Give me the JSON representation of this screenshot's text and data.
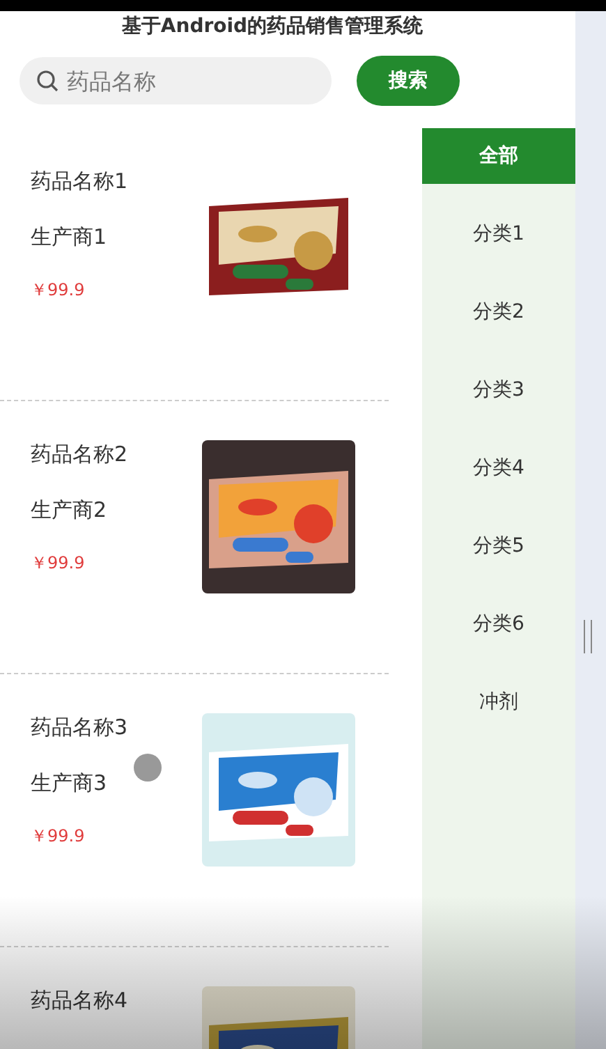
{
  "title": "基于Android的药品销售管理系统",
  "search": {
    "placeholder": "药品名称",
    "button": "搜索"
  },
  "products": [
    {
      "name": "药品名称1",
      "maker": "生产商1",
      "price": "￥99.9"
    },
    {
      "name": "药品名称2",
      "maker": "生产商2",
      "price": "￥99.9"
    },
    {
      "name": "药品名称3",
      "maker": "生产商3",
      "price": "￥99.9"
    },
    {
      "name": "药品名称4"
    }
  ],
  "categories": [
    {
      "label": "全部",
      "selected": true
    },
    {
      "label": "分类1",
      "selected": false
    },
    {
      "label": "分类2",
      "selected": false
    },
    {
      "label": "分类3",
      "selected": false
    },
    {
      "label": "分类4",
      "selected": false
    },
    {
      "label": "分类5",
      "selected": false
    },
    {
      "label": "分类6",
      "selected": false
    },
    {
      "label": "冲剂",
      "selected": false
    }
  ]
}
